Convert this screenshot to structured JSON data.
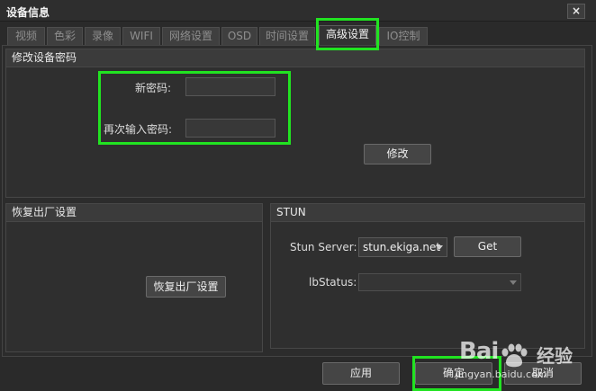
{
  "window": {
    "title": "设备信息",
    "close_glyph": "×"
  },
  "tabs": [
    {
      "label": "视频",
      "active": false
    },
    {
      "label": "色彩",
      "active": false
    },
    {
      "label": "录像",
      "active": false
    },
    {
      "label": "WIFI",
      "active": false
    },
    {
      "label": "网络设置",
      "active": false
    },
    {
      "label": "OSD",
      "active": false
    },
    {
      "label": "时间设置",
      "active": false
    },
    {
      "label": "高级设置",
      "active": true
    },
    {
      "label": "IO控制",
      "active": false
    }
  ],
  "password_group": {
    "title": "修改设备密码",
    "new_password_label": "新密码:",
    "new_password_value": "",
    "confirm_password_label": "再次输入密码:",
    "confirm_password_value": "",
    "modify_button": "修改"
  },
  "reset_group": {
    "title": "恢复出厂设置",
    "reset_button": "恢复出厂设置"
  },
  "stun_group": {
    "title": "STUN",
    "server_label": "Stun Server:",
    "server_value": "stun.ekiga.net",
    "get_button": "Get",
    "status_label": "lbStatus:",
    "status_value": ""
  },
  "footer": {
    "apply_button": "应用",
    "ok_button": "确定",
    "cancel_button": "取消"
  },
  "watermark": {
    "brand": "Bai",
    "chinese": "经验",
    "url": "jingyan.baidu.com"
  },
  "colors": {
    "highlight": "#21e321",
    "background": "#2a2a2a"
  }
}
